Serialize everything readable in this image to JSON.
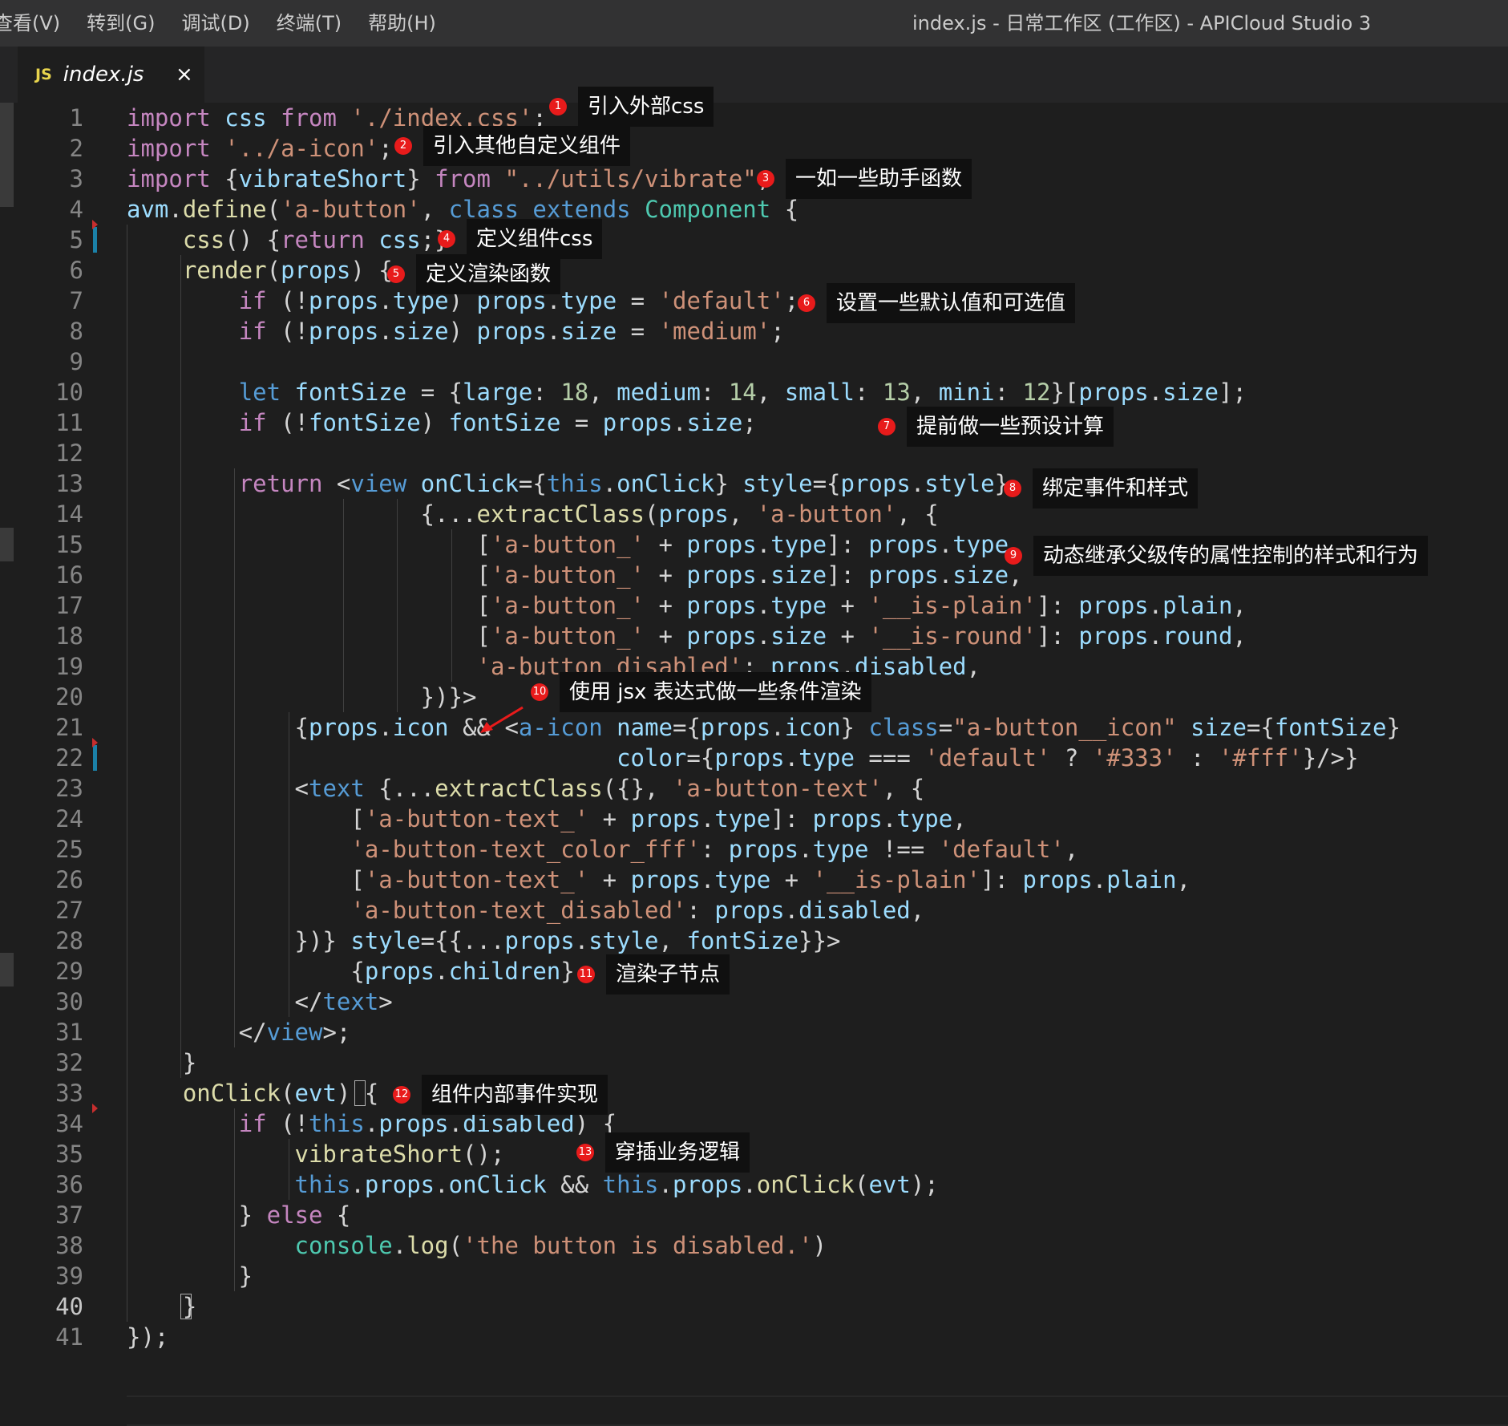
{
  "menu": {
    "items": [
      "查看(V)",
      "转到(G)",
      "调试(D)",
      "终端(T)",
      "帮助(H)"
    ],
    "window_title": "index.js - 日常工作区 (工作区) - APICloud Studio 3"
  },
  "tab": {
    "icon_label": "JS",
    "icon_name": "javascript-file-icon",
    "label": "index.js",
    "close_glyph": "×"
  },
  "editor": {
    "active_line": 40,
    "lines": [
      {
        "n": "1",
        "code": "import css from './index.css';"
      },
      {
        "n": "2",
        "code": "import '../a-icon';"
      },
      {
        "n": "3",
        "code": "import {vibrateShort} from \"../utils/vibrate\";"
      },
      {
        "n": "4",
        "code": "avm.define('a-button', class extends Component {"
      },
      {
        "n": "5",
        "code": "    css() {return css;}"
      },
      {
        "n": "6",
        "code": "    render(props) {"
      },
      {
        "n": "7",
        "code": "        if (!props.type) props.type = 'default';"
      },
      {
        "n": "8",
        "code": "        if (!props.size) props.size = 'medium';"
      },
      {
        "n": "9",
        "code": ""
      },
      {
        "n": "10",
        "code": "        let fontSize = {large: 18, medium: 14, small: 13, mini: 12}[props.size];"
      },
      {
        "n": "11",
        "code": "        if (!fontSize) fontSize = props.size;"
      },
      {
        "n": "12",
        "code": ""
      },
      {
        "n": "13",
        "code": "        return <view onClick={this.onClick} style={props.style}"
      },
      {
        "n": "14",
        "code": "                     {...extractClass(props, 'a-button', {"
      },
      {
        "n": "15",
        "code": "                         ['a-button_' + props.type]: props.type,"
      },
      {
        "n": "16",
        "code": "                         ['a-button_' + props.size]: props.size,"
      },
      {
        "n": "17",
        "code": "                         ['a-button_' + props.type + '__is-plain']: props.plain,"
      },
      {
        "n": "18",
        "code": "                         ['a-button_' + props.size + '__is-round']: props.round,"
      },
      {
        "n": "19",
        "code": "                         'a-button_disabled': props.disabled,"
      },
      {
        "n": "20",
        "code": "                     })}>"
      },
      {
        "n": "21",
        "code": "            {props.icon && <a-icon name={props.icon} class=\"a-button__icon\" size={fontSize}"
      },
      {
        "n": "22",
        "code": "                                   color={props.type === 'default' ? '#333' : '#fff'}/>}"
      },
      {
        "n": "23",
        "code": "            <text {...extractClass({}, 'a-button-text', {"
      },
      {
        "n": "24",
        "code": "                ['a-button-text_' + props.type]: props.type,"
      },
      {
        "n": "25",
        "code": "                'a-button-text_color_fff': props.type !== 'default',"
      },
      {
        "n": "26",
        "code": "                ['a-button-text_' + props.type + '__is-plain']: props.plain,"
      },
      {
        "n": "27",
        "code": "                'a-button-text_disabled': props.disabled,"
      },
      {
        "n": "28",
        "code": "            })} style={{...props.style, fontSize}}>"
      },
      {
        "n": "29",
        "code": "                {props.children}"
      },
      {
        "n": "30",
        "code": "            </text>"
      },
      {
        "n": "31",
        "code": "        </view>;"
      },
      {
        "n": "32",
        "code": "    }"
      },
      {
        "n": "33",
        "code": "    onClick(evt) {"
      },
      {
        "n": "34",
        "code": "        if (!this.props.disabled) {"
      },
      {
        "n": "35",
        "code": "            vibrateShort();"
      },
      {
        "n": "36",
        "code": "            this.props.onClick && this.props.onClick(evt);"
      },
      {
        "n": "37",
        "code": "        } else {"
      },
      {
        "n": "38",
        "code": "            console.log('the button is disabled.')"
      },
      {
        "n": "39",
        "code": "        }"
      },
      {
        "n": "40",
        "code": "    }"
      },
      {
        "n": "41",
        "code": "});"
      }
    ]
  },
  "annotations": [
    {
      "num": "1",
      "text": "引入外部css"
    },
    {
      "num": "2",
      "text": "引入其他自定义组件"
    },
    {
      "num": "3",
      "text": "一如一些助手函数"
    },
    {
      "num": "4",
      "text": "定义组件css"
    },
    {
      "num": "5",
      "text": "定义渲染函数"
    },
    {
      "num": "6",
      "text": "设置一些默认值和可选值"
    },
    {
      "num": "7",
      "text": "提前做一些预设计算"
    },
    {
      "num": "8",
      "text": "绑定事件和样式"
    },
    {
      "num": "9",
      "text": "动态继承父级传的属性控制的样式和行为"
    },
    {
      "num": "10",
      "text": "使用 jsx 表达式做一些条件渲染"
    },
    {
      "num": "11",
      "text": "渲染子节点"
    },
    {
      "num": "12",
      "text": "组件内部事件实现"
    },
    {
      "num": "13",
      "text": "穿插业务逻辑"
    }
  ],
  "colors": {
    "editor_bg": "#1e1e1e",
    "keyword": "#c586c0",
    "storage": "#569cd6",
    "function": "#dcdcaa",
    "string": "#ce9178",
    "number": "#b5cea8",
    "variable": "#9cdcfe",
    "type": "#4ec9b0",
    "badge": "#e81b1b",
    "label_bg": "#101010"
  }
}
